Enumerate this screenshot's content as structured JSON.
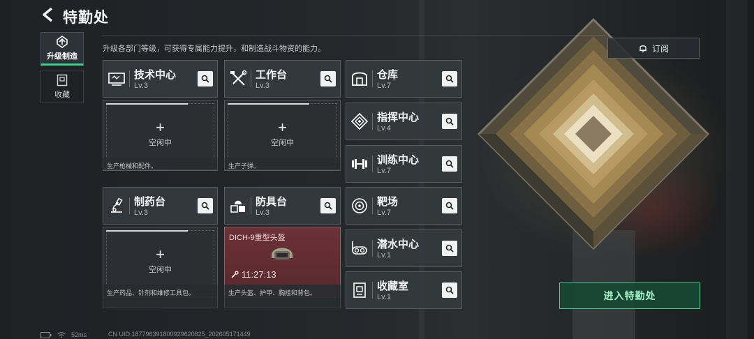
{
  "header": {
    "title": "特勤处"
  },
  "description": "升级各部门等级，可获得专属能力提升，和制造战斗物资的能力。",
  "nav": [
    {
      "label": "升级制造",
      "icon": "upgrade-icon",
      "active": true
    },
    {
      "label": "收藏",
      "icon": "collection-icon",
      "active": false
    }
  ],
  "production": [
    {
      "name": "技术中心",
      "level": "Lv.3",
      "icon": "monitor-icon",
      "status": "空闲中",
      "desc": "生产枪械和配件。",
      "progress": 1.0
    },
    {
      "name": "工作台",
      "level": "Lv.3",
      "icon": "tools-icon",
      "status": "空闲中",
      "desc": "生产子弹。",
      "progress": 0.73
    },
    {
      "name": "制药台",
      "level": "Lv.3",
      "icon": "flask-icon",
      "status": "空闲中",
      "desc": "生产药品、针剂和维修工具包。",
      "progress": 1.0
    },
    {
      "name": "防具台",
      "level": "Lv.3",
      "icon": "armor-icon",
      "item": "DICH-9重型头盔",
      "timer": "11:27:13",
      "desc": "生产头盔、护甲、胸挂和背包。"
    }
  ],
  "facilities": [
    {
      "name": "仓库",
      "level": "Lv.7",
      "icon": "warehouse-icon"
    },
    {
      "name": "指挥中心",
      "level": "Lv.4",
      "icon": "command-icon"
    },
    {
      "name": "训练中心",
      "level": "Lv.7",
      "icon": "dumbbell-icon"
    },
    {
      "name": "靶场",
      "level": "Lv.7",
      "icon": "target-icon"
    },
    {
      "name": "潜水中心",
      "level": "Lv.1",
      "icon": "diving-mask-icon"
    },
    {
      "name": "收藏室",
      "level": "Lv.1",
      "icon": "collection-room-icon"
    }
  ],
  "subscribe_label": "订阅",
  "enter_label": "进入特勤处",
  "status_bar": {
    "ping": "52ms",
    "uid": "CN UID:18779639180092962082​5_202605171449"
  },
  "colors": {
    "accent": "#3dd08c",
    "active_slot": "#6b3236"
  }
}
